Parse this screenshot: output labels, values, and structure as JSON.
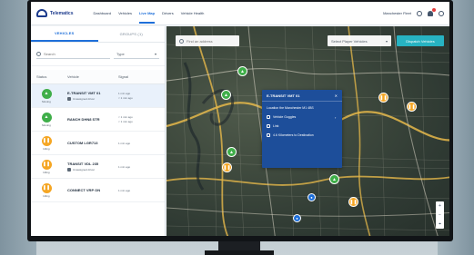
{
  "header": {
    "brand": "Telematics",
    "nav": [
      "Dashboard",
      "Vehicles",
      "Live Map",
      "Drivers",
      "Vehicle Health"
    ],
    "active_nav": "Live Map",
    "user": "Manchester Fleet"
  },
  "sidebar": {
    "tabs": [
      "VEHICLES",
      "GROUPS (1)"
    ],
    "search_placeholder": "Search",
    "filter_label": "Type",
    "columns": [
      "Status",
      "Vehicle",
      "Signal"
    ],
    "rows": [
      {
        "status": "Moving",
        "status_icon": "arrow-up-icon",
        "color": "#3fae49",
        "vehicle": "E-TRANSIT VMT 01",
        "driver": "Unassigned driver",
        "signal": "1 min ago",
        "signal2": "< 1 min ago"
      },
      {
        "status": "Moving",
        "status_icon": "arrow-up-icon",
        "color": "#3fae49",
        "vehicle": "RANCH DHN8 STR",
        "driver": "",
        "signal": "< 1 min ago",
        "signal2": "< 1 min ago"
      },
      {
        "status": "Idling",
        "status_icon": "pause-icon",
        "color": "#f5a623",
        "vehicle": "CUSTOM LGR713",
        "driver": "",
        "signal": "1 min ago",
        "signal2": ""
      },
      {
        "status": "Idling",
        "status_icon": "pause-icon",
        "color": "#f5a623",
        "vehicle": "TRANSIT VDL 235",
        "driver": "Unassigned driver",
        "signal": "1 min ago",
        "signal2": ""
      },
      {
        "status": "Idling",
        "status_icon": "pause-icon",
        "color": "#f5a623",
        "vehicle": "CONNECT VRP ON",
        "driver": "",
        "signal": "1 min ago",
        "signal2": ""
      }
    ]
  },
  "map": {
    "search_placeholder": "Find an address",
    "groups_placeholder": "Select Player Vehicles",
    "dispatch_label": "Dispatch Vehicles",
    "popup": {
      "title": "E-TRANSIT VMT 01",
      "location": "Location the Manchester M1 4BS",
      "lines": [
        "Vehicle Goggles",
        "Link",
        "4.6 Kilometers to Destination"
      ]
    }
  }
}
